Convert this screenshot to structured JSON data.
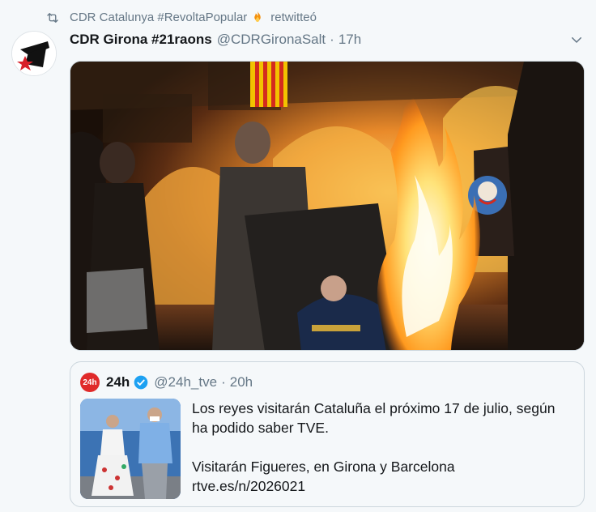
{
  "retweet": {
    "actor": "CDR Catalunya #RevoltaPopular",
    "suffix": "retwitteó",
    "icon": "retweet-icon",
    "emoji": "fire-emoji"
  },
  "tweet": {
    "display_name": "CDR Girona #21raons",
    "handle": "@CDRGironaSalt",
    "separator": "·",
    "time": "17h",
    "media_description": "photo"
  },
  "quote": {
    "avatar_text": "24h",
    "display_name": "24h",
    "handle": "@24h_tve",
    "separator": "·",
    "time": "20h",
    "text_line1": "Los reyes visitarán Cataluña el próximo 17 de julio, según",
    "text_line2": "ha podido saber TVE.",
    "text_line3": "Visitarán Figueres, en Girona y Barcelona",
    "text_line4": "rtve.es/n/2026021"
  },
  "colors": {
    "background": "#f5f8fa",
    "secondary_text": "#657786",
    "primary_text": "#14171a",
    "verified_blue": "#1da1f2",
    "border": "#ccd6dd"
  }
}
